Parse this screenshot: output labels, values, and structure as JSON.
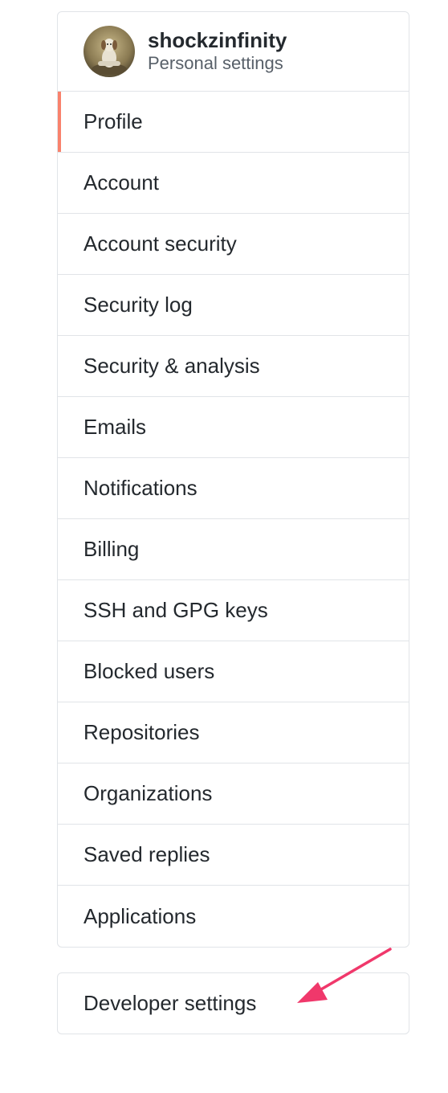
{
  "header": {
    "username": "shockzinfinity",
    "subtitle": "Personal settings"
  },
  "menu": {
    "items": [
      {
        "label": "Profile",
        "selected": true
      },
      {
        "label": "Account"
      },
      {
        "label": "Account security"
      },
      {
        "label": "Security log"
      },
      {
        "label": "Security & analysis"
      },
      {
        "label": "Emails"
      },
      {
        "label": "Notifications"
      },
      {
        "label": "Billing"
      },
      {
        "label": "SSH and GPG keys"
      },
      {
        "label": "Blocked users"
      },
      {
        "label": "Repositories"
      },
      {
        "label": "Organizations"
      },
      {
        "label": "Saved replies"
      },
      {
        "label": "Applications"
      }
    ]
  },
  "developer": {
    "label": "Developer settings"
  },
  "colors": {
    "selected_accent": "#f9826c",
    "annotation_arrow": "#f0386b",
    "border": "#e1e4e8",
    "text": "#24292e",
    "muted_text": "#586069"
  },
  "icons": {
    "avatar": "avatar-image",
    "annotation": "arrow-annotation-icon"
  }
}
